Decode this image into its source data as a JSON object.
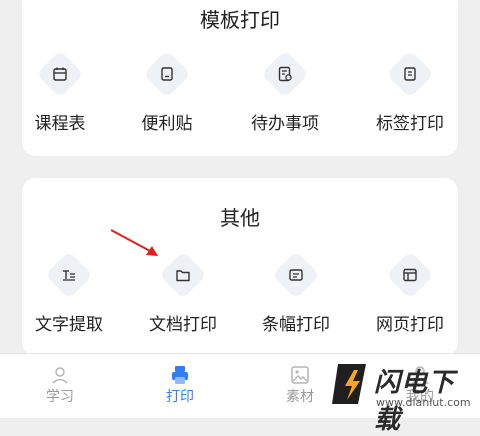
{
  "template_section": {
    "title": "模板打印",
    "items": [
      {
        "label": "课程表",
        "icon": "calendar-icon"
      },
      {
        "label": "便利贴",
        "icon": "sticky-note-icon"
      },
      {
        "label": "待办事项",
        "icon": "todo-list-icon"
      },
      {
        "label": "标签打印",
        "icon": "label-icon"
      }
    ]
  },
  "other_section": {
    "title": "其他",
    "items": [
      {
        "label": "文字提取",
        "icon": "text-extract-icon"
      },
      {
        "label": "文档打印",
        "icon": "folder-icon"
      },
      {
        "label": "条幅打印",
        "icon": "banner-icon"
      },
      {
        "label": "网页打印",
        "icon": "webpage-icon"
      }
    ]
  },
  "bottom_nav": {
    "items": [
      {
        "label": "学习",
        "icon": "study-icon",
        "active": false
      },
      {
        "label": "打印",
        "icon": "printer-icon",
        "active": true
      },
      {
        "label": "素材",
        "icon": "image-icon",
        "active": false
      },
      {
        "label": "我的",
        "icon": "user-icon",
        "active": false
      }
    ]
  },
  "watermark": {
    "title": "闪电下载",
    "url": "www.dianlut.com"
  },
  "colors": {
    "accent": "#2f7cf6",
    "icon_tile": "#eef1f5",
    "arrow": "#e02020",
    "watermark_bolt": "#f5a623"
  }
}
